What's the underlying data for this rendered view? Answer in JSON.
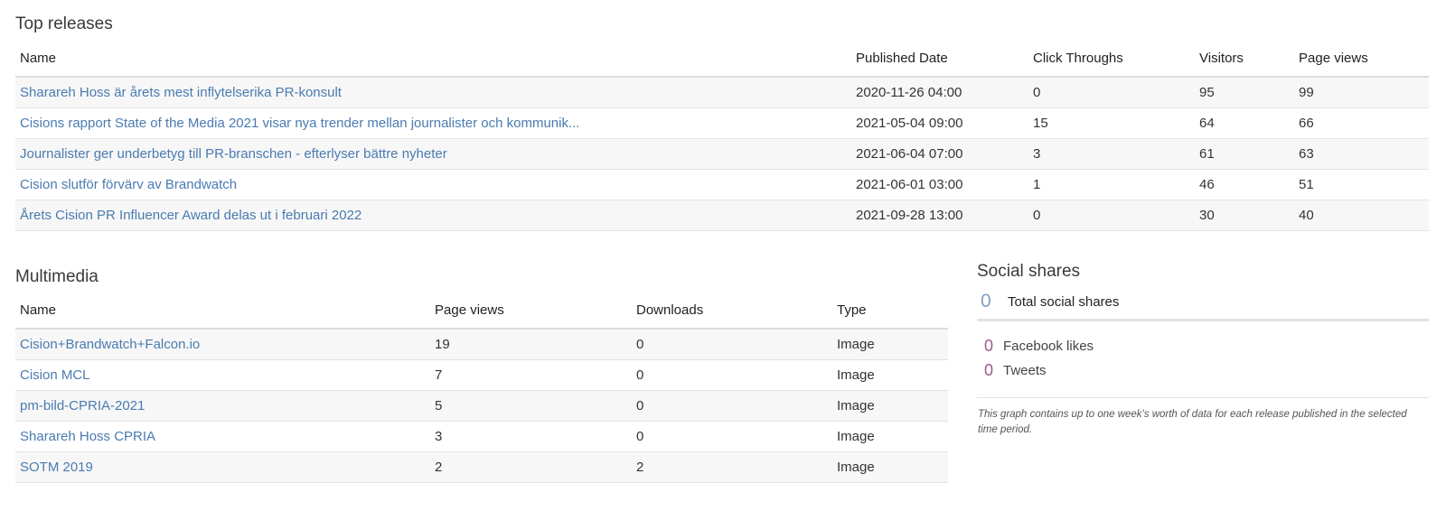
{
  "top_releases": {
    "title": "Top releases",
    "headers": {
      "name": "Name",
      "published": "Published Date",
      "clicks": "Click Throughs",
      "visitors": "Visitors",
      "page_views": "Page views"
    },
    "rows": [
      {
        "name": "Sharareh Hoss är årets mest inflytelserika PR-konsult",
        "published": "2020-11-26 04:00",
        "clicks": "0",
        "visitors": "95",
        "page_views": "99"
      },
      {
        "name": "Cisions rapport State of the Media 2021 visar nya trender mellan journalister och kommunik...",
        "published": "2021-05-04 09:00",
        "clicks": "15",
        "visitors": "64",
        "page_views": "66"
      },
      {
        "name": "Journalister ger underbetyg till PR-branschen - efterlyser bättre nyheter",
        "published": "2021-06-04 07:00",
        "clicks": "3",
        "visitors": "61",
        "page_views": "63"
      },
      {
        "name": "Cision slutför förvärv av Brandwatch",
        "published": "2021-06-01 03:00",
        "clicks": "1",
        "visitors": "46",
        "page_views": "51"
      },
      {
        "name": "Årets Cision PR Influencer Award delas ut i februari 2022",
        "published": "2021-09-28 13:00",
        "clicks": "0",
        "visitors": "30",
        "page_views": "40"
      }
    ]
  },
  "multimedia": {
    "title": "Multimedia",
    "headers": {
      "name": "Name",
      "page_views": "Page views",
      "downloads": "Downloads",
      "type": "Type"
    },
    "rows": [
      {
        "name": "Cision+Brandwatch+Falcon.io",
        "page_views": "19",
        "downloads": "0",
        "type": "Image"
      },
      {
        "name": "Cision MCL",
        "page_views": "7",
        "downloads": "0",
        "type": "Image"
      },
      {
        "name": "pm-bild-CPRIA-2021",
        "page_views": "5",
        "downloads": "0",
        "type": "Image"
      },
      {
        "name": "Sharareh Hoss CPRIA",
        "page_views": "3",
        "downloads": "0",
        "type": "Image"
      },
      {
        "name": "SOTM 2019",
        "page_views": "2",
        "downloads": "2",
        "type": "Image"
      }
    ]
  },
  "social_shares": {
    "title": "Social shares",
    "total_value": "0",
    "total_label": "Total social shares",
    "facebook_value": "0",
    "facebook_label": "Facebook likes",
    "tweets_value": "0",
    "tweets_label": "Tweets",
    "note": "This graph contains up to one week's worth of data for each release published in the selected time period.",
    "colors": {
      "total": "#7fa1c3",
      "breakdown": "#9a5a8a"
    }
  },
  "colors": {
    "link": "#4a7bb0",
    "row_stripe": "#f7f7f7"
  }
}
